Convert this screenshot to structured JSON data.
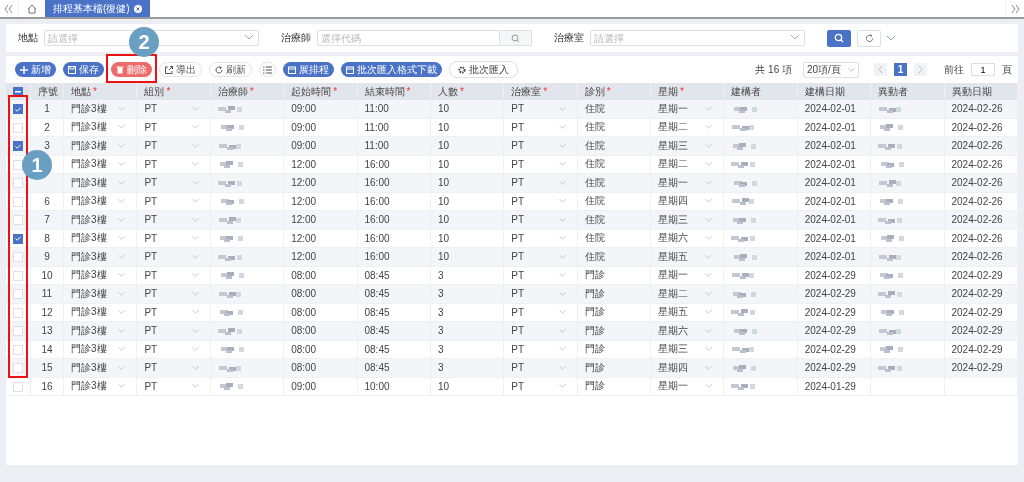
{
  "nav": {
    "tabs": [
      {
        "label": "排程基本檔(復健)",
        "selected": true
      }
    ]
  },
  "filters": [
    {
      "label": "地點",
      "placeholder": "請選擇",
      "kind": "select"
    },
    {
      "label": "治療師",
      "placeholder": "選擇代碼",
      "kind": "lookup"
    },
    {
      "label": "治療室",
      "placeholder": "請選擇",
      "kind": "select"
    }
  ],
  "toolbar": [
    {
      "label": "新增",
      "kind": "primary"
    },
    {
      "label": "保存",
      "kind": "primary"
    },
    {
      "label": "刪除",
      "kind": "danger"
    },
    {
      "label": "導出",
      "kind": "plain"
    },
    {
      "label": "刷新",
      "kind": "plain"
    },
    {
      "kind": "icon"
    },
    {
      "label": "展排程",
      "kind": "primary"
    },
    {
      "label": "批次匯入格式下載",
      "kind": "primary"
    },
    {
      "label": "批次匯入",
      "kind": "outline"
    }
  ],
  "pagination": {
    "total": "共 16 項",
    "page_size": "20項/頁",
    "pages": [
      {
        "label": "1",
        "selected": true
      }
    ],
    "goto_label": "前往",
    "goto_value": "1",
    "goto_suffix": "頁"
  },
  "table": {
    "select_all": {
      "indeterminate": true
    },
    "columns": [
      {
        "label": "序號"
      },
      {
        "label": "地點",
        "marker": "*"
      },
      {
        "label": "組別",
        "marker": "*"
      },
      {
        "label": "治療師",
        "marker": "*"
      },
      {
        "label": "起始時間",
        "marker": "*"
      },
      {
        "label": "結束時間",
        "marker": "*"
      },
      {
        "label": "人數",
        "marker": "*"
      },
      {
        "label": "治療室",
        "marker": "*"
      },
      {
        "label": "診別",
        "marker": "*"
      },
      {
        "label": "星期",
        "marker": "*"
      },
      {
        "label": "建構者"
      },
      {
        "label": "建構日期"
      },
      {
        "label": "異動者"
      },
      {
        "label": "異動日期"
      }
    ],
    "rows": [
      {
        "checked": true,
        "seq": "1",
        "location": "門診3樓",
        "group": "PT",
        "start": "09:00",
        "end": "11:00",
        "count": "10",
        "room": "PT",
        "type": "住院",
        "weekday": "星期一",
        "created": "2024-02-01",
        "modified": "2024-02-26"
      },
      {
        "checked": false,
        "seq": "2",
        "location": "門診3樓",
        "group": "PT",
        "start": "09:00",
        "end": "11:00",
        "count": "10",
        "room": "PT",
        "type": "住院",
        "weekday": "星期二",
        "created": "2024-02-01",
        "modified": "2024-02-26"
      },
      {
        "checked": true,
        "seq": "3",
        "location": "門診3樓",
        "group": "PT",
        "start": "09:00",
        "end": "11:00",
        "count": "10",
        "room": "PT",
        "type": "住院",
        "weekday": "星期三",
        "created": "2024-02-01",
        "modified": "2024-02-26"
      },
      {
        "checked": false,
        "location": "門診3樓",
        "group": "PT",
        "start": "12:00",
        "end": "16:00",
        "count": "10",
        "room": "PT",
        "type": "住院",
        "weekday": "星期二",
        "created": "2024-02-01",
        "modified": "2024-02-26"
      },
      {
        "checked": false,
        "location": "門診3樓",
        "group": "PT",
        "start": "12:00",
        "end": "16:00",
        "count": "10",
        "room": "PT",
        "type": "住院",
        "weekday": "星期一",
        "created": "2024-02-01",
        "modified": "2024-02-26"
      },
      {
        "checked": false,
        "seq": "6",
        "location": "門診3樓",
        "group": "PT",
        "start": "12:00",
        "end": "16:00",
        "count": "10",
        "room": "PT",
        "type": "住院",
        "weekday": "星期四",
        "created": "2024-02-01",
        "modified": "2024-02-26"
      },
      {
        "checked": false,
        "seq": "7",
        "location": "門診3樓",
        "group": "PT",
        "start": "12:00",
        "end": "16:00",
        "count": "10",
        "room": "PT",
        "type": "住院",
        "weekday": "星期三",
        "created": "2024-02-01",
        "modified": "2024-02-26"
      },
      {
        "checked": true,
        "seq": "8",
        "location": "門診3樓",
        "group": "PT",
        "start": "12:00",
        "end": "16:00",
        "count": "10",
        "room": "PT",
        "type": "住院",
        "weekday": "星期六",
        "created": "2024-02-01",
        "modified": "2024-02-26"
      },
      {
        "checked": false,
        "seq": "9",
        "location": "門診3樓",
        "group": "PT",
        "start": "12:00",
        "end": "16:00",
        "count": "10",
        "room": "PT",
        "type": "住院",
        "weekday": "星期五",
        "created": "2024-02-01",
        "modified": "2024-02-26"
      },
      {
        "checked": false,
        "seq": "10",
        "location": "門診3樓",
        "group": "PT",
        "start": "08:00",
        "end": "08:45",
        "count": "3",
        "room": "PT",
        "type": "門診",
        "weekday": "星期一",
        "created": "2024-02-29",
        "modified": "2024-02-29"
      },
      {
        "checked": false,
        "seq": "11",
        "location": "門診3樓",
        "group": "PT",
        "start": "08:00",
        "end": "08:45",
        "count": "3",
        "room": "PT",
        "type": "門診",
        "weekday": "星期二",
        "created": "2024-02-29",
        "modified": "2024-02-29"
      },
      {
        "checked": false,
        "seq": "12",
        "location": "門診3樓",
        "group": "PT",
        "start": "08:00",
        "end": "08:45",
        "count": "3",
        "room": "PT",
        "type": "門診",
        "weekday": "星期五",
        "created": "2024-02-29",
        "modified": "2024-02-29"
      },
      {
        "checked": false,
        "seq": "13",
        "location": "門診3樓",
        "group": "PT",
        "start": "08:00",
        "end": "08:45",
        "count": "3",
        "room": "PT",
        "type": "門診",
        "weekday": "星期六",
        "created": "2024-02-29",
        "modified": "2024-02-29"
      },
      {
        "checked": false,
        "seq": "14",
        "location": "門診3樓",
        "group": "PT",
        "start": "08:00",
        "end": "08:45",
        "count": "3",
        "room": "PT",
        "type": "門診",
        "weekday": "星期三",
        "created": "2024-02-29",
        "modified": "2024-02-29"
      },
      {
        "checked": false,
        "seq": "15",
        "location": "門診3樓",
        "group": "PT",
        "start": "08:00",
        "end": "08:45",
        "count": "3",
        "room": "PT",
        "type": "門診",
        "weekday": "星期四",
        "created": "2024-02-29",
        "modified": "2024-02-29"
      },
      {
        "checked": false,
        "seq": "16",
        "location": "門診3樓",
        "group": "PT",
        "start": "09:00",
        "end": "10:00",
        "count": "10",
        "room": "PT",
        "type": "門診",
        "weekday": "星期一",
        "created": "2024-01-29"
      }
    ]
  },
  "annotations": [
    {
      "label": "1"
    },
    {
      "label": "2"
    }
  ]
}
